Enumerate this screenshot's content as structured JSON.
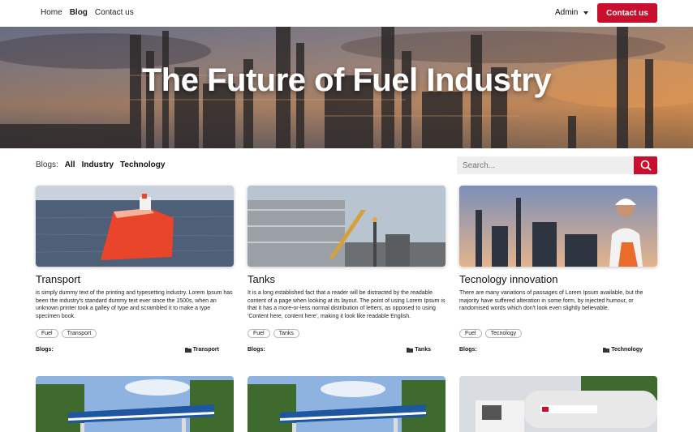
{
  "nav": {
    "links": [
      "Home",
      "Blog",
      "Contact us"
    ],
    "active": "Blog",
    "admin_label": "Admin",
    "cta_label": "Contact us"
  },
  "hero": {
    "title": "The Future of Fuel Industry"
  },
  "filters": {
    "label": "Blogs:",
    "options": [
      "All",
      "Industry",
      "Technology"
    ]
  },
  "search": {
    "placeholder": "Search..."
  },
  "cards": [
    {
      "title": "Transport",
      "desc": "is simply dummy text of the printing and typesetting industry. Lorem Ipsum has been the industry's standard dummy text ever since the 1500s, when an unknown printer took a galley of type and scrambled it to make a type specimen book.",
      "tags": [
        "Fuel",
        "Transport"
      ],
      "foot_label": "Blogs:",
      "category": "Transport"
    },
    {
      "title": "Tanks",
      "desc": "It is a long established fact that a reader will be distracted by the readable content of a page when looking at its layout. The point of using Lorem Ipsum is that it has a more-or-less normal distribution of letters, as opposed to using 'Content here, content here', making it look like readable English.",
      "tags": [
        "Fuel",
        "Tanks"
      ],
      "foot_label": "Blogs:",
      "category": "Tanks"
    },
    {
      "title": "Tecnology innovation",
      "desc": "There are many variations of passages of Lorem Ipsum available, but the majority have suffered alteration in some form, by injected humour, or randomised words which don't look even slightly believable.",
      "tags": [
        "Fuel",
        "Tecnology"
      ],
      "foot_label": "Blogs:",
      "category": "Technology"
    }
  ],
  "colors": {
    "accent": "#c8102e"
  }
}
